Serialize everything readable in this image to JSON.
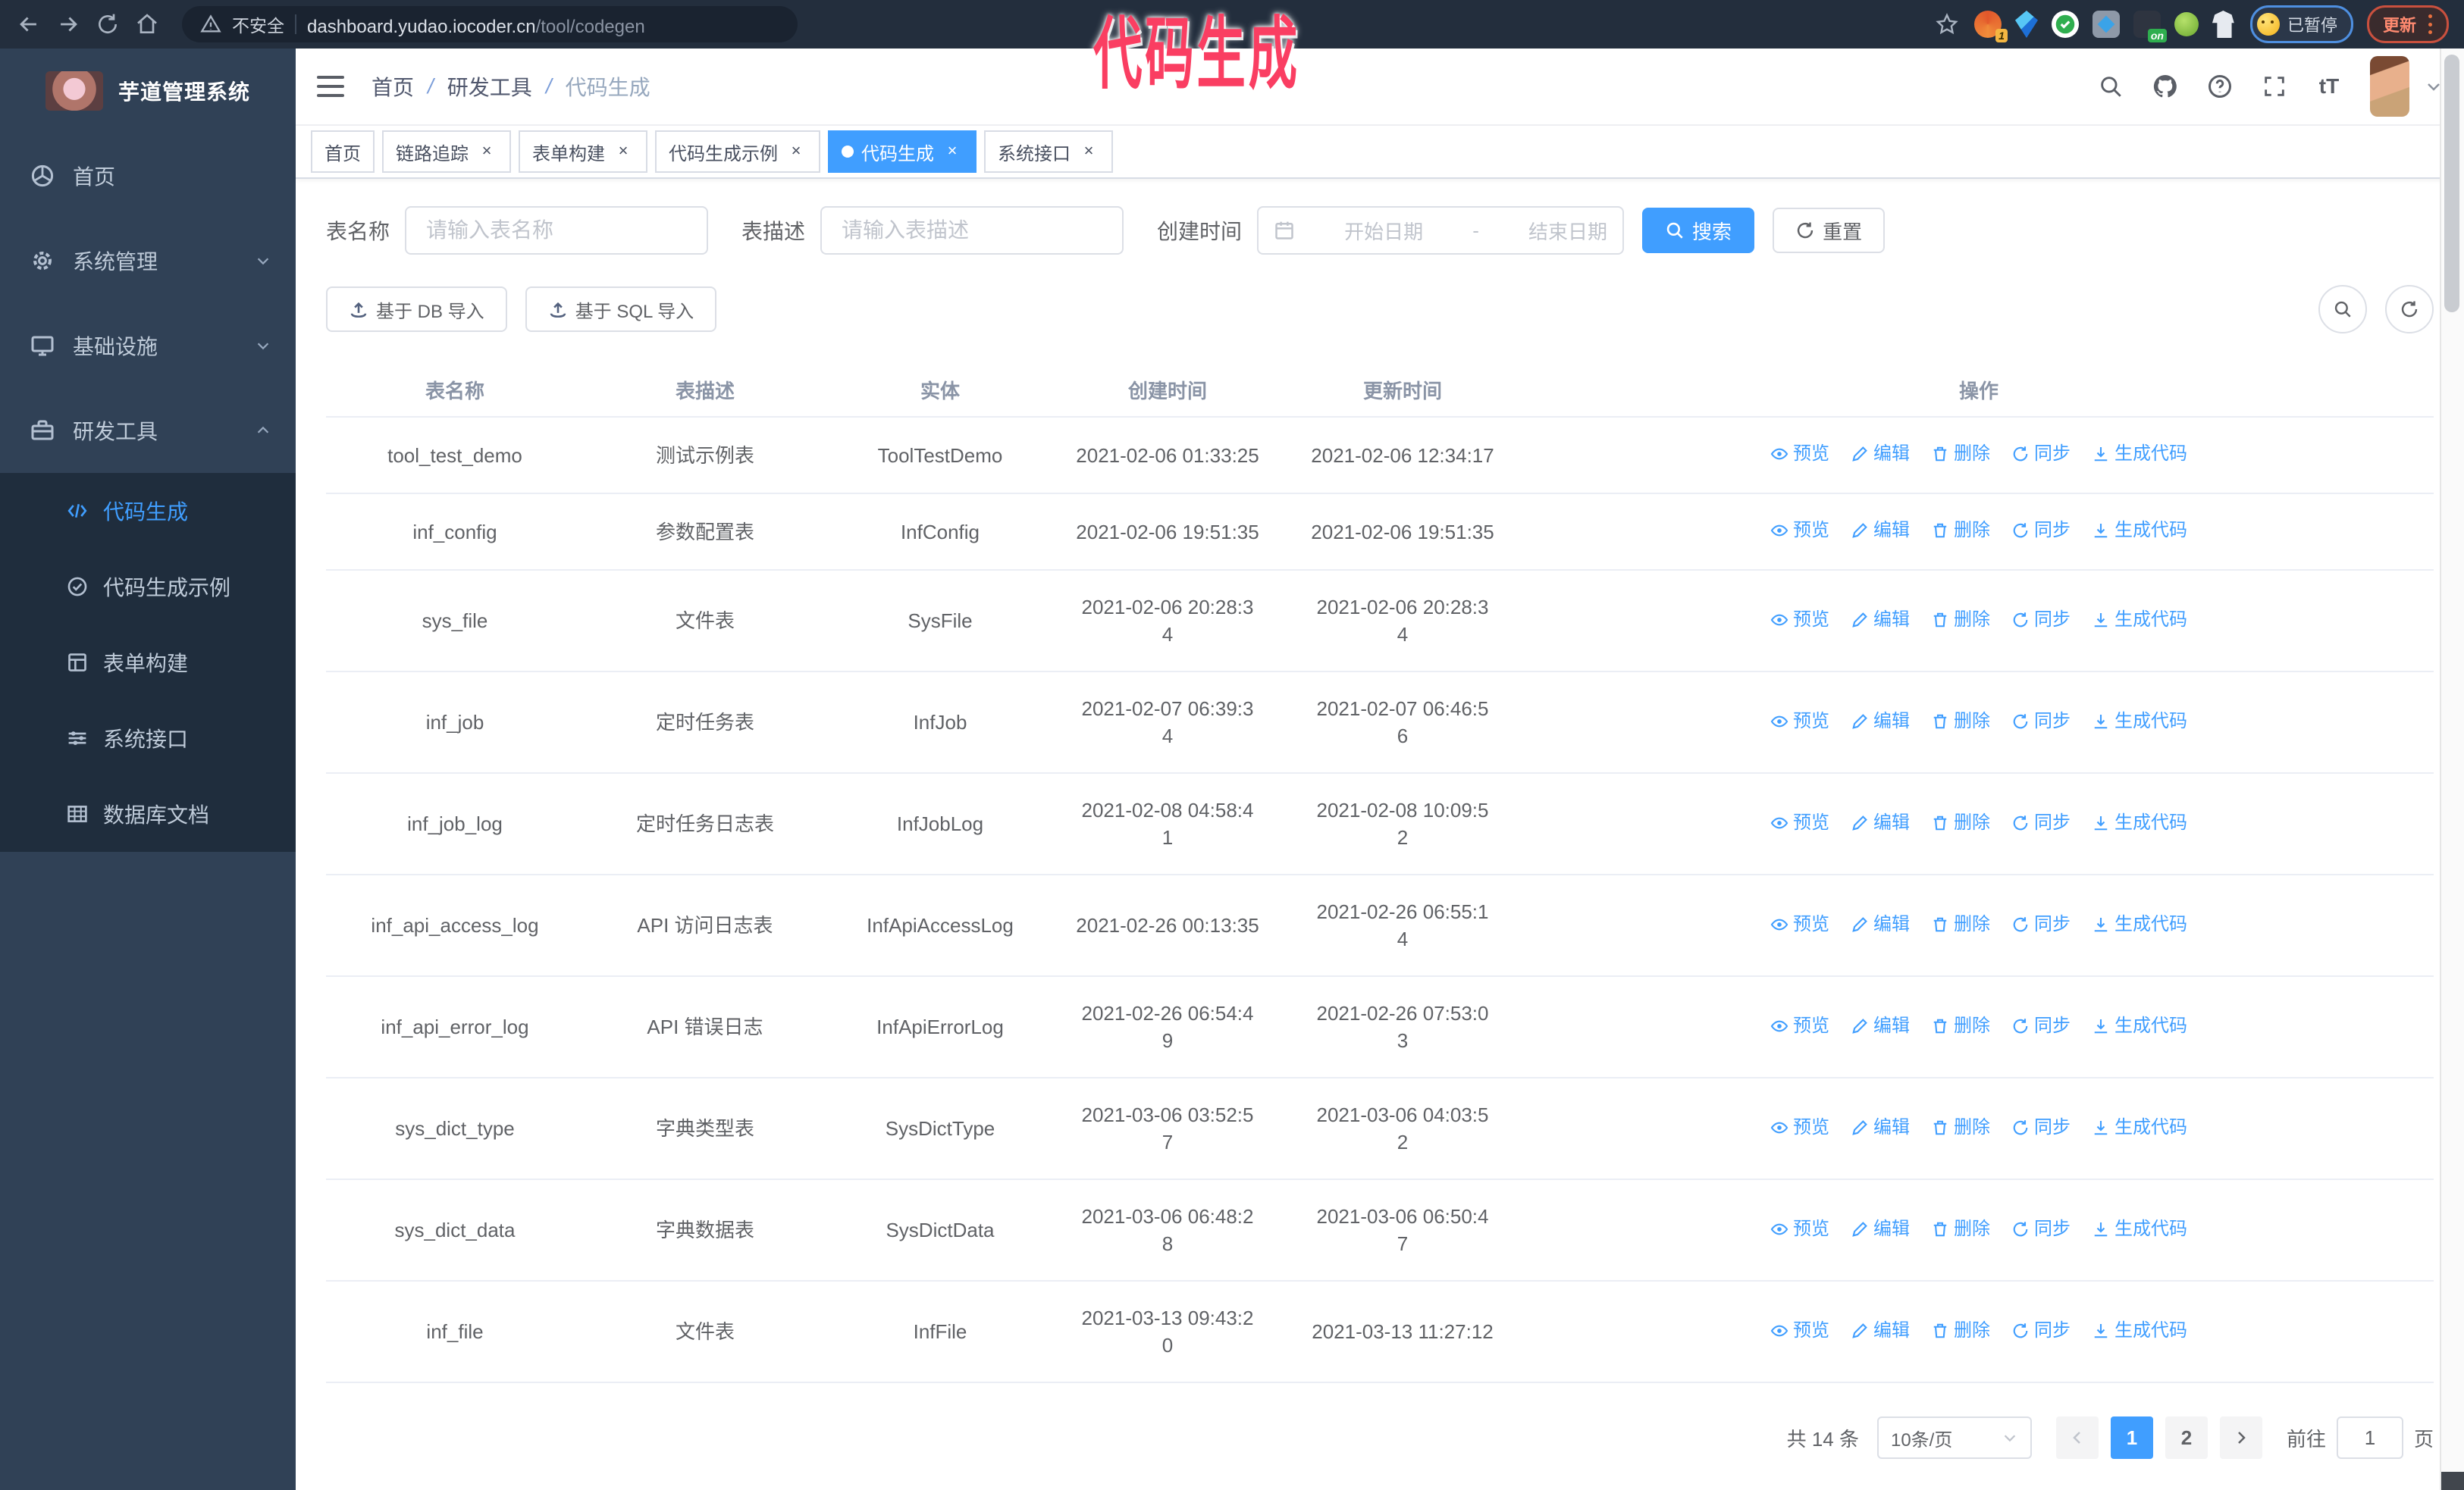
{
  "browser": {
    "security_text": "不安全",
    "url_host": "dashboard.yudao.iocoder.cn",
    "url_path": "/tool/codegen",
    "ext_badge": "1",
    "ext_on_badge": "on",
    "paused_label": "已暂停",
    "update_label": "更新"
  },
  "annotation": {
    "text": "代码生成",
    "color": "#fa3e62"
  },
  "sidebar": {
    "title": "芋道管理系统",
    "menu": [
      {
        "label": "首页",
        "icon": "dashboard-icon",
        "arrow": "",
        "expanded": false
      },
      {
        "label": "系统管理",
        "icon": "gear-icon",
        "arrow": "down",
        "expanded": false
      },
      {
        "label": "基础设施",
        "icon": "monitor-icon",
        "arrow": "down",
        "expanded": false
      },
      {
        "label": "研发工具",
        "icon": "toolbox-icon",
        "arrow": "up",
        "expanded": true
      }
    ],
    "submenu": [
      {
        "label": "代码生成",
        "icon": "code-icon",
        "active": true
      },
      {
        "label": "代码生成示例",
        "icon": "check-circle-icon",
        "active": false
      },
      {
        "label": "表单构建",
        "icon": "form-icon",
        "active": false
      },
      {
        "label": "系统接口",
        "icon": "sliders-icon",
        "active": false
      },
      {
        "label": "数据库文档",
        "icon": "table-grid-icon",
        "active": false
      }
    ]
  },
  "navbar": {
    "breadcrumb": [
      "首页",
      "研发工具",
      "代码生成"
    ]
  },
  "tabs": [
    {
      "label": "首页",
      "closable": false,
      "active": false
    },
    {
      "label": "链路追踪",
      "closable": true,
      "active": false
    },
    {
      "label": "表单构建",
      "closable": true,
      "active": false
    },
    {
      "label": "代码生成示例",
      "closable": true,
      "active": false
    },
    {
      "label": "代码生成",
      "closable": true,
      "active": true
    },
    {
      "label": "系统接口",
      "closable": true,
      "active": false
    }
  ],
  "filters": {
    "name_label": "表名称",
    "name_placeholder": "请输入表名称",
    "desc_label": "表描述",
    "desc_placeholder": "请输入表描述",
    "time_label": "创建时间",
    "start_placeholder": "开始日期",
    "range_separator": "-",
    "end_placeholder": "结束日期",
    "search_label": "搜索",
    "reset_label": "重置"
  },
  "toolbar": {
    "import_db_label": "基于 DB 导入",
    "import_sql_label": "基于 SQL 导入"
  },
  "table": {
    "columns": [
      "表名称",
      "表描述",
      "实体",
      "创建时间",
      "更新时间",
      "操作"
    ],
    "action_labels": [
      "预览",
      "编辑",
      "删除",
      "同步",
      "生成代码"
    ],
    "rows": [
      {
        "name": "tool_test_demo",
        "desc": "测试示例表",
        "entity": "ToolTestDemo",
        "created": "2021-02-06 01:33:25",
        "created_wrap": false,
        "updated": "2021-02-06 12:34:17",
        "updated_wrap": false
      },
      {
        "name": "inf_config",
        "desc": "参数配置表",
        "entity": "InfConfig",
        "created": "2021-02-06 19:51:35",
        "created_wrap": false,
        "updated": "2021-02-06 19:51:35",
        "updated_wrap": false
      },
      {
        "name": "sys_file",
        "desc": "文件表",
        "entity": "SysFile",
        "created": "2021-02-06 20:28:34",
        "created_wrap": true,
        "updated": "2021-02-06 20:28:34",
        "updated_wrap": true
      },
      {
        "name": "inf_job",
        "desc": "定时任务表",
        "entity": "InfJob",
        "created": "2021-02-07 06:39:34",
        "created_wrap": true,
        "updated": "2021-02-07 06:46:56",
        "updated_wrap": true
      },
      {
        "name": "inf_job_log",
        "desc": "定时任务日志表",
        "entity": "InfJobLog",
        "created": "2021-02-08 04:58:41",
        "created_wrap": true,
        "updated": "2021-02-08 10:09:52",
        "updated_wrap": true
      },
      {
        "name": "inf_api_access_log",
        "desc": "API 访问日志表",
        "entity": "InfApiAccessLog",
        "created": "2021-02-26 00:13:35",
        "created_wrap": false,
        "updated": "2021-02-26 06:55:14",
        "updated_wrap": true
      },
      {
        "name": "inf_api_error_log",
        "desc": "API 错误日志",
        "entity": "InfApiErrorLog",
        "created": "2021-02-26 06:54:49",
        "created_wrap": true,
        "updated": "2021-02-26 07:53:03",
        "updated_wrap": true
      },
      {
        "name": "sys_dict_type",
        "desc": "字典类型表",
        "entity": "SysDictType",
        "created": "2021-03-06 03:52:57",
        "created_wrap": true,
        "updated": "2021-03-06 04:03:52",
        "updated_wrap": true
      },
      {
        "name": "sys_dict_data",
        "desc": "字典数据表",
        "entity": "SysDictData",
        "created": "2021-03-06 06:48:28",
        "created_wrap": true,
        "updated": "2021-03-06 06:50:47",
        "updated_wrap": true
      },
      {
        "name": "inf_file",
        "desc": "文件表",
        "entity": "InfFile",
        "created": "2021-03-13 09:43:20",
        "created_wrap": true,
        "updated": "2021-03-13 11:27:12",
        "updated_wrap": false
      }
    ]
  },
  "pagination": {
    "total_text": "共 14 条",
    "page_size_text": "10条/页",
    "pages": [
      "1",
      "2"
    ],
    "active_page": "1",
    "goto_label": "前往",
    "goto_value": "1",
    "goto_unit": "页"
  },
  "colors": {
    "primary": "#409eff",
    "sidebar_bg": "#304156",
    "submenu_bg": "#1f2d3d",
    "annotation": "#fa3e62"
  }
}
